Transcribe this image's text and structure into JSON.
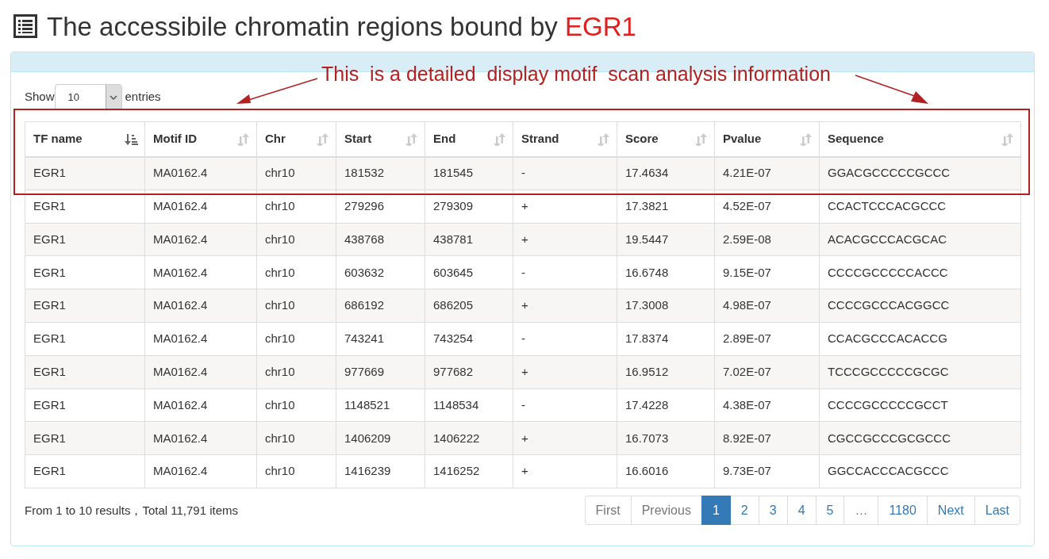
{
  "heading": {
    "text": "The accessibile chromatin regions bound by",
    "highlight": "EGR1"
  },
  "annotation": {
    "text": "This  is a detailed  display motif  scan analysis information"
  },
  "length_menu": {
    "before": "Show",
    "value": "10",
    "after": "entries"
  },
  "table": {
    "columns": [
      {
        "label": "TF name",
        "sorted": true
      },
      {
        "label": "Motif ID",
        "sorted": false
      },
      {
        "label": "Chr",
        "sorted": false
      },
      {
        "label": "Start",
        "sorted": false
      },
      {
        "label": "End",
        "sorted": false
      },
      {
        "label": "Strand",
        "sorted": false
      },
      {
        "label": "Score",
        "sorted": false
      },
      {
        "label": "Pvalue",
        "sorted": false
      },
      {
        "label": "Sequence",
        "sorted": false
      }
    ],
    "rows": [
      [
        "EGR1",
        "MA0162.4",
        "chr10",
        "181532",
        "181545",
        "-",
        "17.4634",
        "4.21E-07",
        "GGACGCCCCCGCCC"
      ],
      [
        "EGR1",
        "MA0162.4",
        "chr10",
        "279296",
        "279309",
        "+",
        "17.3821",
        "4.52E-07",
        "CCACTCCCACGCCC"
      ],
      [
        "EGR1",
        "MA0162.4",
        "chr10",
        "438768",
        "438781",
        "+",
        "19.5447",
        "2.59E-08",
        "ACACGCCCACGCAC"
      ],
      [
        "EGR1",
        "MA0162.4",
        "chr10",
        "603632",
        "603645",
        "-",
        "16.6748",
        "9.15E-07",
        "CCCCGCCCCCACCC"
      ],
      [
        "EGR1",
        "MA0162.4",
        "chr10",
        "686192",
        "686205",
        "+",
        "17.3008",
        "4.98E-07",
        "CCCCGCCCACGGCC"
      ],
      [
        "EGR1",
        "MA0162.4",
        "chr10",
        "743241",
        "743254",
        "-",
        "17.8374",
        "2.89E-07",
        "CCACGCCCACACCG"
      ],
      [
        "EGR1",
        "MA0162.4",
        "chr10",
        "977669",
        "977682",
        "+",
        "16.9512",
        "7.02E-07",
        "TCCCGCCCCCGCGC"
      ],
      [
        "EGR1",
        "MA0162.4",
        "chr10",
        "1148521",
        "1148534",
        "-",
        "17.4228",
        "4.38E-07",
        "CCCCGCCCCCGCCT"
      ],
      [
        "EGR1",
        "MA0162.4",
        "chr10",
        "1406209",
        "1406222",
        "+",
        "16.7073",
        "8.92E-07",
        "CGCCGCCCGCGCCC"
      ],
      [
        "EGR1",
        "MA0162.4",
        "chr10",
        "1416239",
        "1416252",
        "+",
        "16.6016",
        "9.73E-07",
        "GGCCACCCACGCCC"
      ]
    ]
  },
  "info": "From 1 to 10 results，Total 11,791 items",
  "pagination": [
    {
      "label": "First",
      "selected": false,
      "disabled": true
    },
    {
      "label": "Previous",
      "selected": false,
      "disabled": true
    },
    {
      "label": "1",
      "selected": true,
      "disabled": false
    },
    {
      "label": "2",
      "selected": false,
      "disabled": false
    },
    {
      "label": "3",
      "selected": false,
      "disabled": false
    },
    {
      "label": "4",
      "selected": false,
      "disabled": false
    },
    {
      "label": "5",
      "selected": false,
      "disabled": false
    },
    {
      "label": "…",
      "selected": false,
      "disabled": true
    },
    {
      "label": "1180",
      "selected": false,
      "disabled": false
    },
    {
      "label": "Next",
      "selected": false,
      "disabled": false
    },
    {
      "label": "Last",
      "selected": false,
      "disabled": false
    }
  ]
}
